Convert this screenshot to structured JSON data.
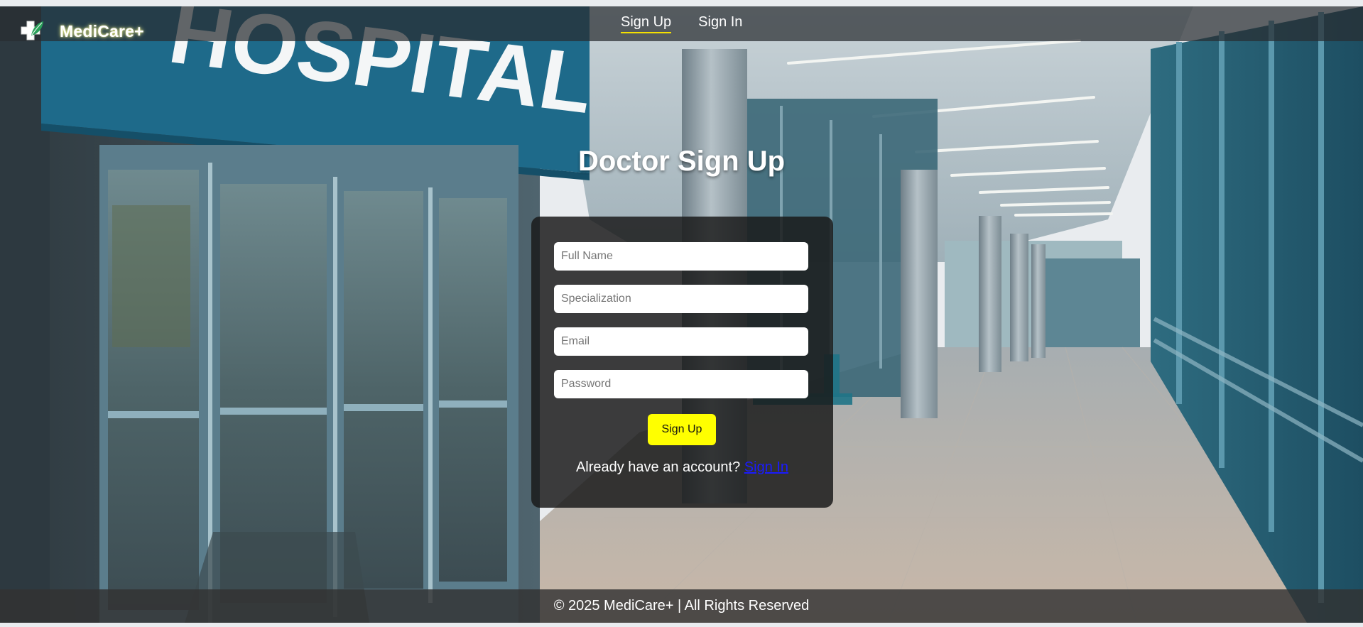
{
  "brand": {
    "name": "MediCare+",
    "logo_icon": "medical-cross-leaf-icon"
  },
  "nav": {
    "items": [
      {
        "label": "Sign Up",
        "active": true
      },
      {
        "label": "Sign In",
        "active": false
      }
    ]
  },
  "background": {
    "sign_text": "HOSPITAL"
  },
  "form": {
    "title": "Doctor Sign Up",
    "fields": {
      "full_name": {
        "placeholder": "Full Name",
        "value": ""
      },
      "specialization": {
        "placeholder": "Specialization",
        "value": ""
      },
      "email": {
        "placeholder": "Email",
        "value": ""
      },
      "password": {
        "placeholder": "Password",
        "value": ""
      }
    },
    "submit_label": "Sign Up",
    "account_prompt": "Already have an account?",
    "signin_link": "Sign In"
  },
  "footer": {
    "text": "© 2025 MediCare+ | All Rights Reserved"
  },
  "colors": {
    "accent": "#ffff00",
    "nav_underline": "#f5e000",
    "link": "#1a1aff",
    "card_bg": "#191919"
  }
}
